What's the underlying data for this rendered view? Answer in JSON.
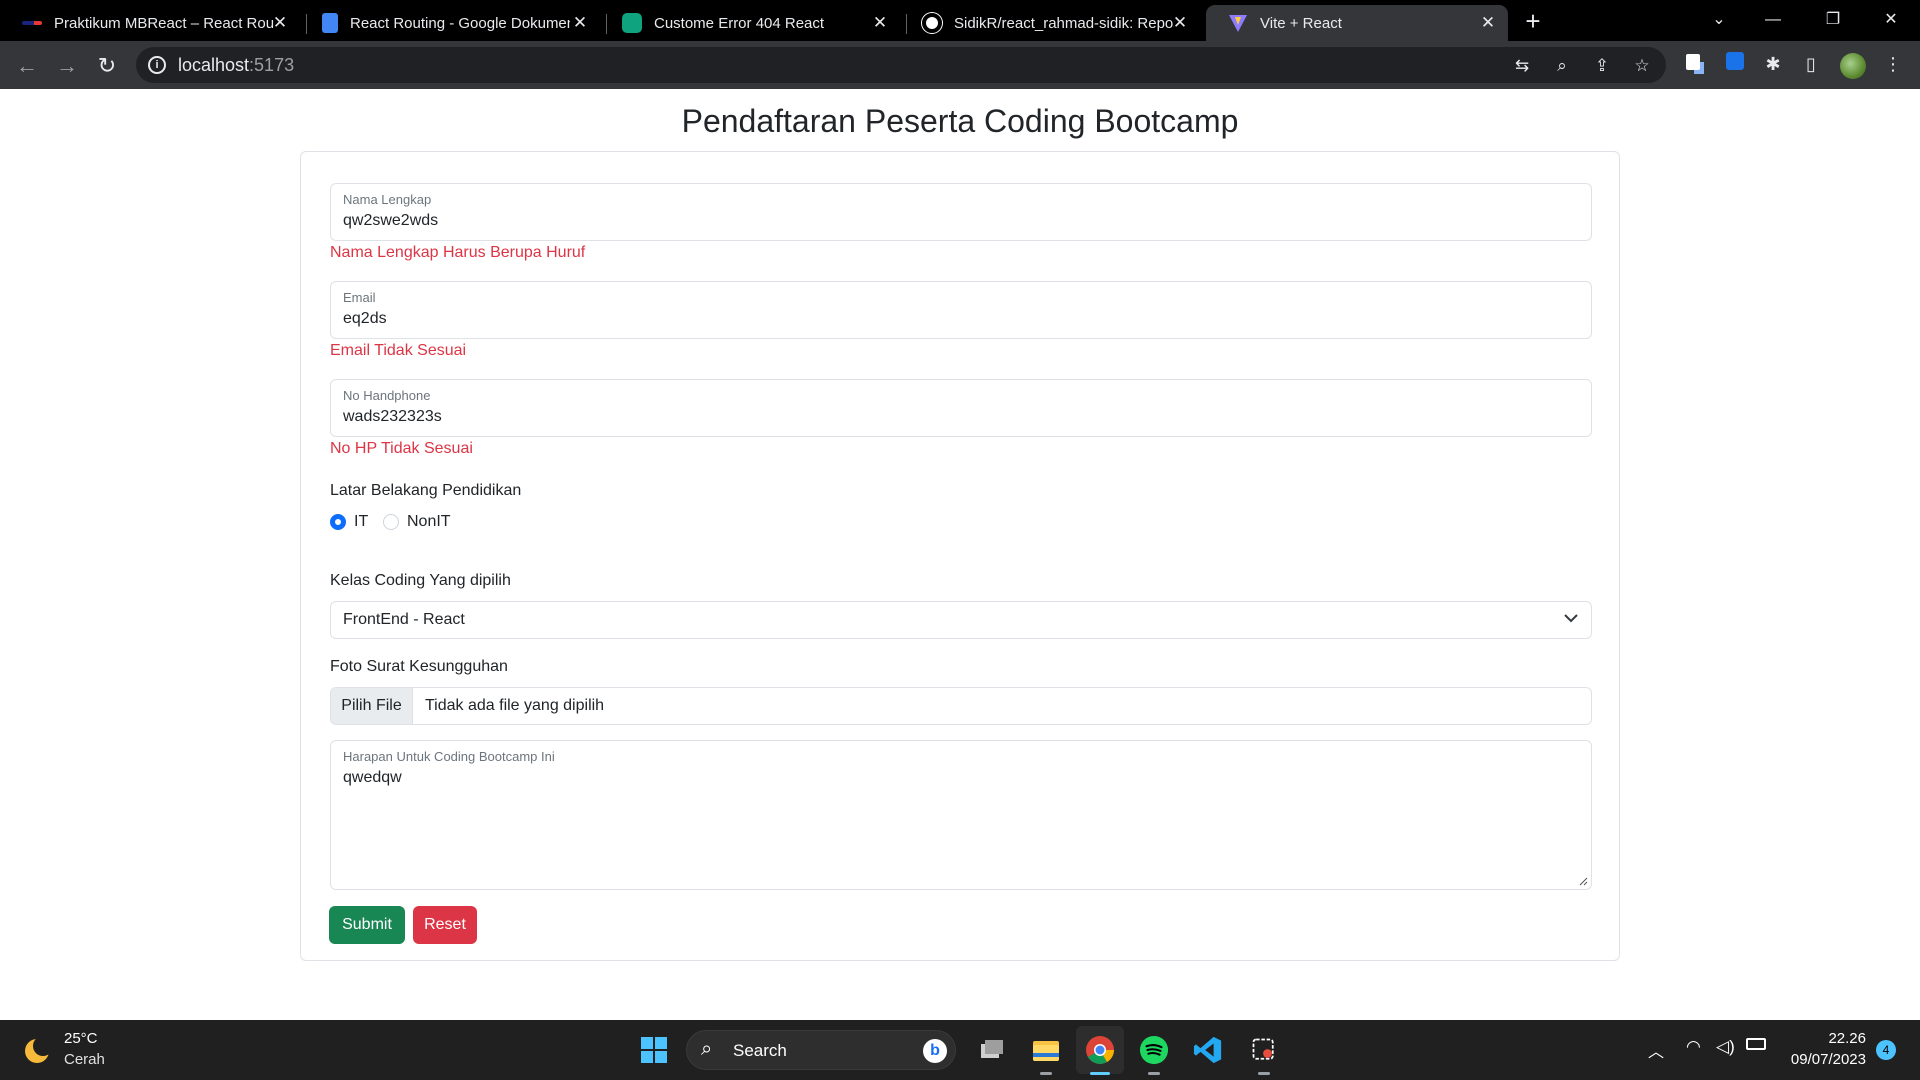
{
  "browser": {
    "tabs": [
      {
        "title": "Praktikum MBReact – React Routi",
        "icon": "mb-favicon",
        "active": false
      },
      {
        "title": "React Routing - Google Dokumen",
        "icon": "google-docs-icon",
        "active": false
      },
      {
        "title": "Custome Error 404 React",
        "icon": "chatgpt-icon",
        "active": false
      },
      {
        "title": "SidikR/react_rahmad-sidik: Repos",
        "icon": "github-icon",
        "active": false
      },
      {
        "title": "Vite + React",
        "icon": "vite-icon",
        "active": true
      }
    ],
    "url_host": "localhost",
    "url_port": ":5173"
  },
  "page": {
    "heading": "Pendaftaran Peserta Coding Bootcamp",
    "fields": {
      "nama": {
        "label": "Nama Lengkap",
        "value": "qw2swe2wds",
        "error": "Nama Lengkap Harus Berupa Huruf"
      },
      "email": {
        "label": "Email",
        "value": "eq2ds",
        "error": "Email Tidak Sesuai"
      },
      "hp": {
        "label": "No Handphone",
        "value": "wads232323s",
        "error": "No HP Tidak Sesuai"
      }
    },
    "pendidikan": {
      "label": "Latar Belakang Pendidikan",
      "options": [
        {
          "label": "IT",
          "checked": true
        },
        {
          "label": "NonIT",
          "checked": false
        }
      ]
    },
    "kelas": {
      "label": "Kelas Coding Yang dipilih",
      "selected": "FrontEnd - React"
    },
    "foto": {
      "label": "Foto Surat Kesungguhan",
      "button": "Pilih File",
      "status": "Tidak ada file yang dipilih"
    },
    "harapan": {
      "label": "Harapan Untuk Coding Bootcamp Ini",
      "value": "qwedqw"
    },
    "buttons": {
      "submit": "Submit",
      "reset": "Reset"
    }
  },
  "taskbar": {
    "weather_temp": "25°C",
    "weather_desc": "Cerah",
    "search_label": "Search",
    "time": "22.26",
    "date": "09/07/2023",
    "notification_count": "4"
  },
  "colors": {
    "primary": "#0d6efd",
    "danger": "#dc3545",
    "success": "#198754"
  }
}
